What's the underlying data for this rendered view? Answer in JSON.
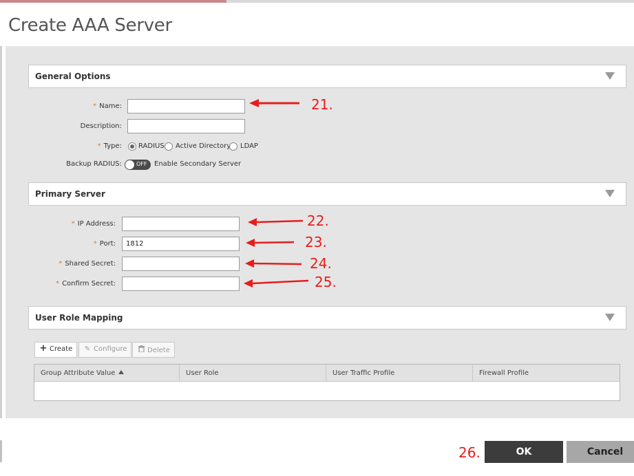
{
  "progress": {
    "fraction": 0.357
  },
  "dialog": {
    "title": "Create AAA Server"
  },
  "general_options": {
    "title": "General Options",
    "name_label": "Name:",
    "name_value": "",
    "description_label": "Description:",
    "description_value": "",
    "type_label": "Type:",
    "type_options": [
      "RADIUS",
      "Active Directory",
      "LDAP"
    ],
    "type_selected": "RADIUS",
    "backup_label": "Backup RADIUS:",
    "backup_toggle_state": "OFF",
    "backup_toggle_text": "Enable Secondary Server"
  },
  "primary_server": {
    "title": "Primary Server",
    "ip_label": "IP Address:",
    "ip_value": "",
    "port_label": "Port:",
    "port_value": "1812",
    "secret_label": "Shared Secret:",
    "secret_value": "",
    "confirm_label": "Confirm Secret:",
    "confirm_value": ""
  },
  "user_role_mapping": {
    "title": "User Role Mapping",
    "toolbar": {
      "create": "Create",
      "configure": "Configure",
      "delete": "Delete"
    },
    "columns": [
      "Group Attribute Value",
      "User Role",
      "User Traffic Profile",
      "Firewall Profile"
    ]
  },
  "annotations": {
    "a21": "21.",
    "a22": "22.",
    "a23": "23.",
    "a24": "24.",
    "a25": "25.",
    "a26": "26."
  },
  "footer": {
    "ok": "OK",
    "cancel": "Cancel"
  },
  "colors": {
    "annotation": "#e81c1c",
    "required_marker": "#e07b21",
    "ok_button": "#3c3c3c",
    "cancel_button": "#a7a7a7"
  },
  "icons": {
    "create": "plus-icon",
    "configure": "pencil-icon",
    "delete": "trash-icon",
    "sort": "sort-ascending-icon",
    "collapse": "chevron-down-icon"
  }
}
